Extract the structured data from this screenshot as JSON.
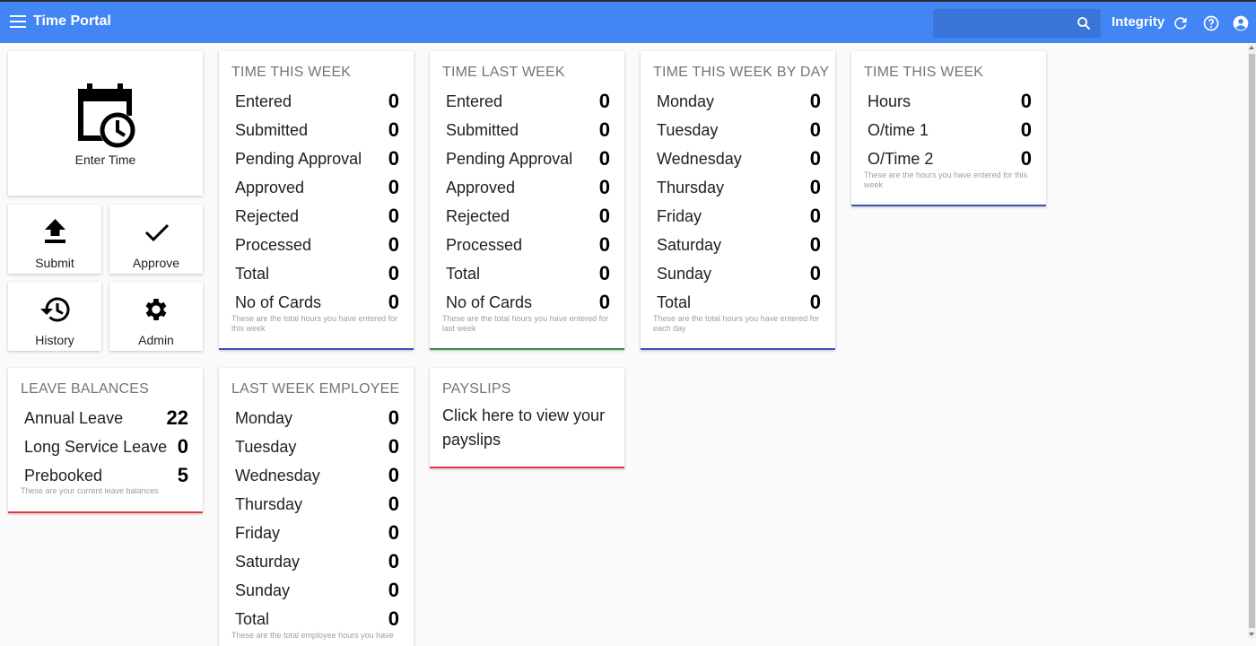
{
  "header": {
    "title": "Time Portal",
    "search_placeholder": "",
    "user_label": "Integrity"
  },
  "tiles": {
    "enter_time": "Enter Time",
    "submit": "Submit",
    "approve": "Approve",
    "history": "History",
    "admin": "Admin"
  },
  "panels": {
    "time_this_week": {
      "title": "TIME THIS WEEK",
      "rows": [
        {
          "label": "Entered",
          "value": "0"
        },
        {
          "label": "Submitted",
          "value": "0"
        },
        {
          "label": "Pending Approval",
          "value": "0"
        },
        {
          "label": "Approved",
          "value": "0"
        },
        {
          "label": "Rejected",
          "value": "0"
        },
        {
          "label": "Processed",
          "value": "0"
        },
        {
          "label": "Total",
          "value": "0"
        },
        {
          "label": "No of Cards",
          "value": "0"
        }
      ],
      "note": "These are the total hours you have entered for this week"
    },
    "time_last_week": {
      "title": "TIME LAST WEEK",
      "rows": [
        {
          "label": "Entered",
          "value": "0"
        },
        {
          "label": "Submitted",
          "value": "0"
        },
        {
          "label": "Pending Approval",
          "value": "0"
        },
        {
          "label": "Approved",
          "value": "0"
        },
        {
          "label": "Rejected",
          "value": "0"
        },
        {
          "label": "Processed",
          "value": "0"
        },
        {
          "label": "Total",
          "value": "0"
        },
        {
          "label": "No of Cards",
          "value": "0"
        }
      ],
      "note": "These are the total hours you have entered for last week"
    },
    "time_by_day": {
      "title": "TIME THIS WEEK BY DAY",
      "rows": [
        {
          "label": "Monday",
          "value": "0"
        },
        {
          "label": "Tuesday",
          "value": "0"
        },
        {
          "label": "Wednesday",
          "value": "0"
        },
        {
          "label": "Thursday",
          "value": "0"
        },
        {
          "label": "Friday",
          "value": "0"
        },
        {
          "label": "Saturday",
          "value": "0"
        },
        {
          "label": "Sunday",
          "value": "0"
        },
        {
          "label": "Total",
          "value": "0"
        }
      ],
      "note": "These are the total hours you have entered for each day"
    },
    "time_this_week_hours": {
      "title": "TIME THIS WEEK",
      "rows": [
        {
          "label": "Hours",
          "value": "0"
        },
        {
          "label": "O/time 1",
          "value": "0"
        },
        {
          "label": "O/Time 2",
          "value": "0"
        }
      ],
      "note": "These are the hours you have entered for this week"
    },
    "leave_balances": {
      "title": "LEAVE BALANCES",
      "rows": [
        {
          "label": "Annual Leave",
          "value": "22"
        },
        {
          "label": "Long Service Leave",
          "value": "0"
        },
        {
          "label": "Prebooked",
          "value": "5"
        }
      ],
      "note": "These are your current leave balances"
    },
    "last_week_employee": {
      "title": "LAST WEEK EMPLOYEE",
      "rows": [
        {
          "label": "Monday",
          "value": "0"
        },
        {
          "label": "Tuesday",
          "value": "0"
        },
        {
          "label": "Wednesday",
          "value": "0"
        },
        {
          "label": "Thursday",
          "value": "0"
        },
        {
          "label": "Friday",
          "value": "0"
        },
        {
          "label": "Saturday",
          "value": "0"
        },
        {
          "label": "Sunday",
          "value": "0"
        },
        {
          "label": "Total",
          "value": "0"
        }
      ],
      "note": "These are the total employee hours you have"
    },
    "payslips": {
      "title": "PAYSLIPS",
      "link_text": "Click here to view your payslips"
    }
  },
  "colors": {
    "header": "#4285f4",
    "accent_blue": "#3f51b5",
    "accent_green": "#388e3c",
    "accent_red": "#e53935"
  }
}
